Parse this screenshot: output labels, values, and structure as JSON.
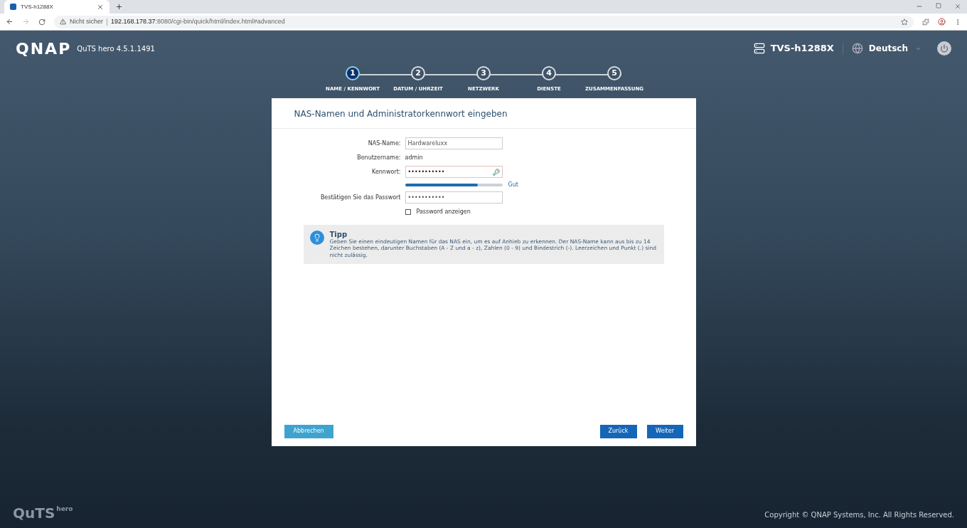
{
  "browser": {
    "tab_title": "TVS-h1288X",
    "security": "Nicht sicher",
    "url_host": "192.168.178.37",
    "url_rest": ":8080/cgi-bin/quick/html/index.html#advanced"
  },
  "header": {
    "logo": "QNAP",
    "version": "QuTS hero 4.5.1.1491",
    "device": "TVS-h1288X",
    "language": "Deutsch"
  },
  "steps": [
    {
      "number": "1",
      "label": "NAME / KENNWORT",
      "selected": true
    },
    {
      "number": "2",
      "label": "DATUM / UHRZEIT",
      "selected": false
    },
    {
      "number": "3",
      "label": "NETZWERK",
      "selected": false
    },
    {
      "number": "4",
      "label": "DIENSTE",
      "selected": false
    },
    {
      "number": "5",
      "label": "ZUSAMMENFASSUNG",
      "selected": false
    }
  ],
  "dialog": {
    "title": "NAS-Namen und Administratorkennwort eingeben",
    "fields": [
      {
        "kind": "input",
        "label": "NAS-Name:",
        "value": "Hardwareluxx"
      },
      {
        "kind": "text",
        "label": "Benutzername:",
        "value": "admin"
      },
      {
        "kind": "password",
        "label": "Kennwort:",
        "value": "•••••••••••"
      },
      {
        "kind": "strength",
        "level": 0.75,
        "reading": "Gut"
      },
      {
        "kind": "input",
        "label": "Bestätigen Sie das Passwort",
        "value": "•••••••••••"
      },
      {
        "kind": "checkbox",
        "label": "Password anzeigen",
        "checked": false
      }
    ],
    "tip": {
      "title": "Tipp",
      "text": "Geben Sie einen eindeutigen Namen für das NAS ein, um es auf Anhieb zu erkennen. Der NAS-Name kann aus bis zu 14 Zeichen bestehen, darunter Buchstaben (A - Z und a - z), Zahlen (0 - 9) und Bindestrich (-). Leerzeichen und Punkt (.) sind nicht zulässig."
    },
    "buttons": {
      "cancel": "Abbrechen",
      "back": "Zurück",
      "next": "Weiter"
    }
  },
  "footer": {
    "logo": "QuTS",
    "logo_sub": "hero",
    "copyright": "Copyright © QNAP Systems, Inc. All Rights Reserved."
  }
}
